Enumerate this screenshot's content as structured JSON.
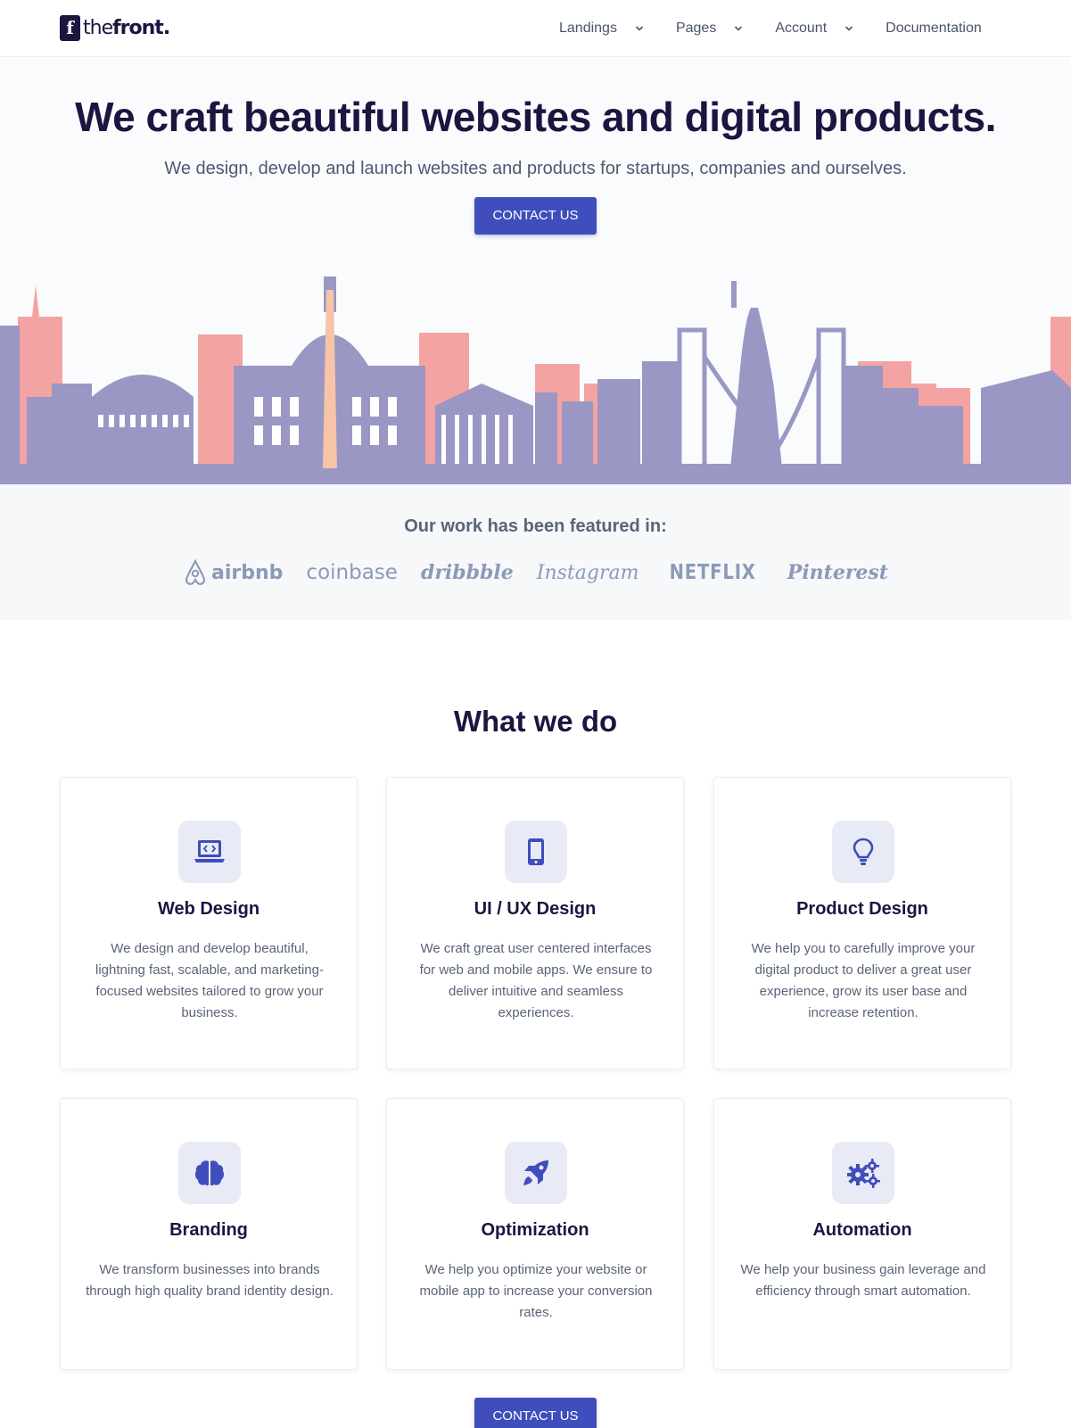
{
  "brand": {
    "name_thin": "the",
    "name_bold": "front.",
    "mark": "f"
  },
  "nav": {
    "items": [
      {
        "label": "Landings",
        "has_dropdown": true
      },
      {
        "label": "Pages",
        "has_dropdown": true
      },
      {
        "label": "Account",
        "has_dropdown": true
      },
      {
        "label": "Documentation",
        "has_dropdown": false
      }
    ]
  },
  "hero": {
    "title": "We craft beautiful websites and digital products.",
    "subtitle": "We design, develop and launch websites and products for startups, companies and ourselves.",
    "cta_label": "CONTACT US"
  },
  "featured": {
    "title": "Our work has been featured in:",
    "brands": [
      "airbnb",
      "coinbase",
      "dribbble",
      "Instagram",
      "NETFLIX",
      "Pinterest"
    ]
  },
  "services": {
    "title": "What we do",
    "items": [
      {
        "title": "Web Design",
        "text": "We design and develop beautiful, lightning fast, scalable, and marketing-focused websites tailored to grow your business.",
        "icon": "laptop-code-icon"
      },
      {
        "title": "UI / UX Design",
        "text": "We craft great user centered interfaces for web and mobile apps. We ensure to deliver intuitive and seamless experiences.",
        "icon": "mobile-icon"
      },
      {
        "title": "Product Design",
        "text": "We help you to carefully improve your digital product to deliver a great user experience, grow its user base and increase retention.",
        "icon": "lightbulb-icon"
      },
      {
        "title": "Branding",
        "text": "We transform businesses into brands through high quality brand identity design.",
        "icon": "brain-icon"
      },
      {
        "title": "Optimization",
        "text": "We help you optimize your website or mobile app to increase your conversion rates.",
        "icon": "rocket-icon"
      },
      {
        "title": "Automation",
        "text": "We help your business gain leverage and efficiency through smart automation.",
        "icon": "cogs-icon"
      }
    ],
    "cta_label": "CONTACT US"
  },
  "colors": {
    "primary": "#3f4dbd",
    "heading": "#1a1640",
    "text": "#5a6478",
    "icon_bg": "#e8eaf6",
    "skyline_purple": "#9a97c4",
    "skyline_pink": "#f4a3a3"
  }
}
